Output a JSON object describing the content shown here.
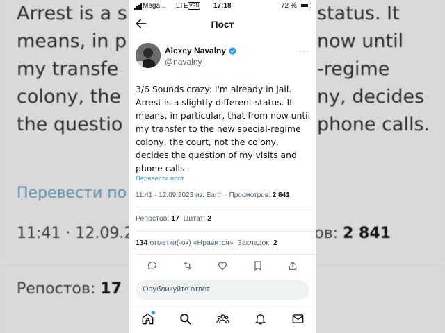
{
  "background": {
    "text_lines": [
      "Arrest is a s",
      "means, in p",
      "my transfe",
      "colony, the",
      "the questio"
    ],
    "text_right": [
      "status. It",
      "now until",
      "-regime",
      "ny, decides",
      "phone calls."
    ],
    "translate": "Перевести по",
    "meta": "11:41 · 12.09.2",
    "views_label": "отров:",
    "views_value": "2 841",
    "reposts_label": "Репостов:",
    "reposts_value": "17"
  },
  "status_bar": {
    "carrier": "Mega...",
    "network": "LTE",
    "vpn": "VPN",
    "time": "17:18",
    "battery": "72 %"
  },
  "header": {
    "title": "Пост"
  },
  "author": {
    "name": "Alexey Navalny",
    "handle": "@navalny",
    "more": "···"
  },
  "tweet": {
    "text": "3/6 Sounds crazy: I'm already in jail. Arrest is a slightly different status. It means, in particular, that from now until my transfer to the new special-regime colony, the court, not the colony, decides the question of my visits and phone calls.",
    "translate_label": "Перевести пост",
    "meta_prefix": "11:41 · 12.09.2023 из: Earth · Просмотров: ",
    "views": "2 841"
  },
  "stats": {
    "reposts_label": "Репостов:",
    "reposts_value": "17",
    "quotes_label": "Цитат:",
    "quotes_value": "2",
    "likes_value": "134",
    "likes_label": "отметки(-ок) «Нравится»",
    "bookmarks_label": "Закладок:",
    "bookmarks_value": "2"
  },
  "reply": {
    "placeholder": "Опубликуйте ответ"
  },
  "colors": {
    "accent": "#1d9bf0",
    "text": "#0f1419",
    "secondary": "#536471"
  }
}
